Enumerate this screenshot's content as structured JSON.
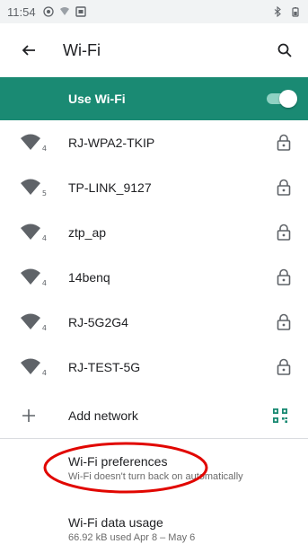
{
  "status_bar": {
    "time": "11:54",
    "left_icons": [
      "circle-at-icon",
      "signal-icon",
      "image-icon"
    ],
    "right_icons": [
      "bluetooth-icon",
      "battery-icon"
    ]
  },
  "app_bar": {
    "title": "Wi-Fi"
  },
  "wifi_toggle": {
    "label": "Use Wi-Fi",
    "on": true,
    "accent_color": "#1a8a73"
  },
  "networks": [
    {
      "ssid": "RJ-WPA2-TKIP",
      "badge": "4",
      "secured": true
    },
    {
      "ssid": "TP-LINK_9127",
      "badge": "5",
      "secured": true
    },
    {
      "ssid": "ztp_ap",
      "badge": "4",
      "secured": true
    },
    {
      "ssid": "14benq",
      "badge": "4",
      "secured": true
    },
    {
      "ssid": "RJ-5G2G4",
      "badge": "4",
      "secured": true
    },
    {
      "ssid": "RJ-TEST-5G",
      "badge": "4",
      "secured": true
    }
  ],
  "add_network": {
    "label": "Add network"
  },
  "preferences": [
    {
      "title": "Wi-Fi preferences",
      "summary": "Wi-Fi doesn't turn back on automatically"
    },
    {
      "title": "Wi-Fi data usage",
      "summary": "66.92 kB used Apr 8 – May 6"
    }
  ],
  "annotation_color": "#e10600"
}
